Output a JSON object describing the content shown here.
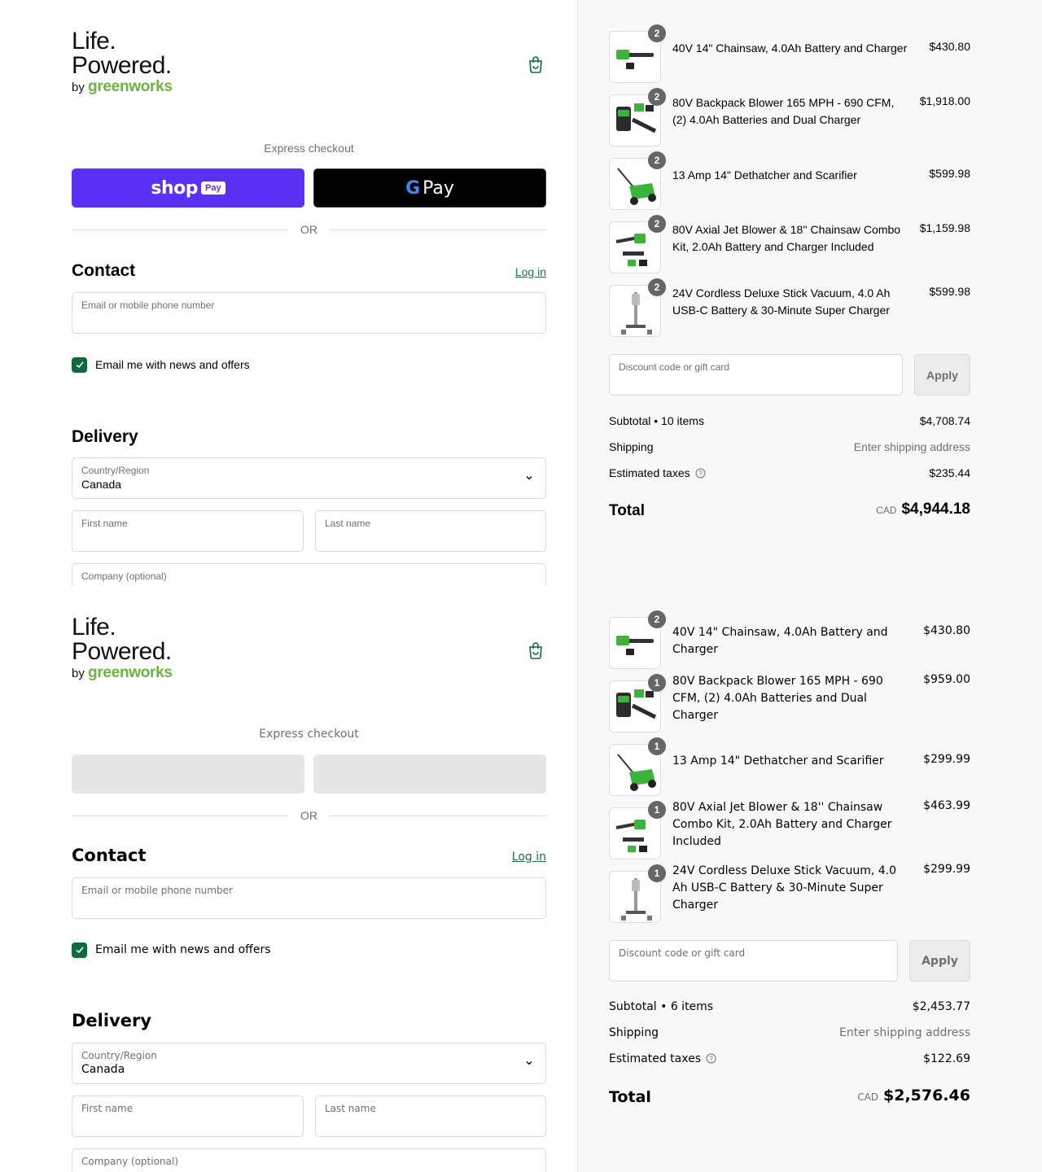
{
  "brand": {
    "line1": "Life.",
    "line2": "Powered.",
    "by": "by",
    "name": "greenworks",
    "accent_color": "#6cb33f"
  },
  "colors": {
    "shop_pay": "#5a31f4",
    "checkbox": "#0f6b3c",
    "link": "#1f6f45"
  },
  "icons": {
    "cart": "shopping-bag-icon",
    "checkbox": "check-icon",
    "select": "chevron-down-icon",
    "taxes": "help-circle-icon"
  },
  "panels": [
    {
      "express_label": "Express checkout",
      "shop_pay": {
        "shop": "shop",
        "pay": "Pay"
      },
      "google_pay": {
        "g": "G",
        "pay": "Pay"
      },
      "or_label": "OR",
      "contact": {
        "title": "Contact",
        "login": "Log in",
        "email_label": "Email or mobile phone number",
        "newsletter_label": "Email me with news and offers"
      },
      "delivery": {
        "title": "Delivery",
        "country_label": "Country/Region",
        "country_value": "Canada",
        "first_name_label": "First name",
        "last_name_label": "Last name",
        "company_label": "Company (optional)"
      },
      "items": [
        {
          "qty": "2",
          "name": "40V 14\" Chainsaw, 4.0Ah Battery and Charger",
          "price": "$430.80"
        },
        {
          "qty": "2",
          "name": "80V Backpack Blower 165 MPH - 690 CFM, (2) 4.0Ah Batteries and Dual Charger",
          "price": "$1,918.00"
        },
        {
          "qty": "2",
          "name": "13 Amp 14\" Dethatcher and Scarifier",
          "price": "$599.98"
        },
        {
          "qty": "2",
          "name": "80V Axial Jet Blower & 18'' Chainsaw Combo Kit, 2.0Ah Battery and Charger Included",
          "price": "$1,159.98"
        },
        {
          "qty": "2",
          "name": "24V Cordless Deluxe Stick Vacuum, 4.0 Ah USB-C Battery & 30-Minute Super Charger",
          "price": "$599.98"
        }
      ],
      "discount_label": "Discount code or gift card",
      "apply_label": "Apply",
      "summary": {
        "subtotal_label": "Subtotal • 10 items",
        "subtotal_value": "$4,708.74",
        "shipping_label": "Shipping",
        "shipping_value": "Enter shipping address",
        "taxes_label": "Estimated taxes",
        "taxes_value": "$235.44",
        "total_label": "Total",
        "currency": "CAD",
        "total_value": "$4,944.18"
      }
    },
    {
      "express_label": "Express checkout",
      "or_label": "OR",
      "contact": {
        "title": "Contact",
        "login": "Log in",
        "email_label": "Email or mobile phone number",
        "newsletter_label": "Email me with news and offers"
      },
      "delivery": {
        "title": "Delivery",
        "country_label": "Country/Region",
        "country_value": "Canada",
        "first_name_label": "First name",
        "last_name_label": "Last name",
        "company_label": "Company (optional)"
      },
      "items": [
        {
          "qty": "2",
          "name": "40V 14\" Chainsaw, 4.0Ah Battery and Charger",
          "price": "$430.80"
        },
        {
          "qty": "1",
          "name": "80V Backpack Blower 165 MPH - 690 CFM, (2) 4.0Ah Batteries and Dual Charger",
          "price": "$959.00"
        },
        {
          "qty": "1",
          "name": "13 Amp 14\" Dethatcher and Scarifier",
          "price": "$299.99"
        },
        {
          "qty": "1",
          "name": "80V Axial Jet Blower & 18'' Chainsaw Combo Kit, 2.0Ah Battery and Charger Included",
          "price": "$463.99"
        },
        {
          "qty": "1",
          "name": "24V Cordless Deluxe Stick Vacuum, 4.0 Ah USB-C Battery & 30-Minute Super Charger",
          "price": "$299.99"
        }
      ],
      "discount_label": "Discount code or gift card",
      "apply_label": "Apply",
      "summary": {
        "subtotal_label": "Subtotal • 6 items",
        "subtotal_value": "$2,453.77",
        "shipping_label": "Shipping",
        "shipping_value": "Enter shipping address",
        "taxes_label": "Estimated taxes",
        "taxes_value": "$122.69",
        "total_label": "Total",
        "currency": "CAD",
        "total_value": "$2,576.46"
      }
    }
  ]
}
